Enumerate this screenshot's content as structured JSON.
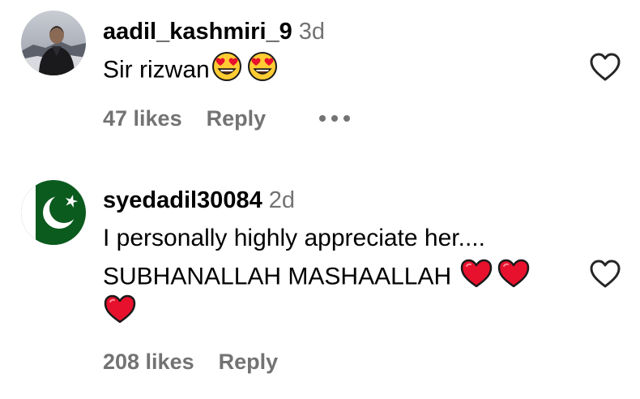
{
  "comments": [
    {
      "username": "aadil_kashmiri_9",
      "time": "3d",
      "text": "Sir rizwan",
      "emoji": [
        "heart-eyes-emoji",
        "heart-eyes-emoji"
      ],
      "likes": "47 likes",
      "reply": "Reply",
      "avatar": "profile-photo"
    },
    {
      "username": "syedadil30084",
      "time": "2d",
      "line1": "I personally highly appreciate her....",
      "line2": "SUBHANALLAH MASHAALLAH",
      "emoji": [
        "red-heart-emoji",
        "red-heart-emoji",
        "red-heart-emoji"
      ],
      "likes": "208 likes",
      "reply": "Reply",
      "avatar": "pakistan-flag",
      "avatar_colors": {
        "green": "#0b5a1e",
        "white": "#ffffff"
      }
    }
  ],
  "icons": {
    "like": "heart-outline-icon",
    "more": "more-options-icon"
  },
  "colors": {
    "secondary_text": "#737373",
    "heart_red": "#e8112d"
  }
}
